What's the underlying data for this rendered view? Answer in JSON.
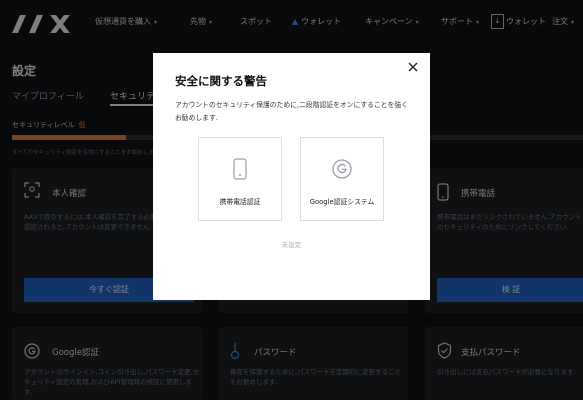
{
  "nav": {
    "logo": "AAX",
    "items": [
      "仮想通貨を購入",
      "先物",
      "スポット",
      "ウォレット",
      "キャンペーン",
      "サポート"
    ],
    "wallet_label": "ウォレット",
    "order_label": "注文"
  },
  "page": {
    "title": "設定",
    "tabs": [
      "マイプロフィール",
      "セキュリティ"
    ],
    "security_level_label": "セキュリティレベル",
    "security_level_value": "低",
    "security_level_fraction": 0.2,
    "hint": "すべてのセキュリティ設定を有効にすることをお勧めします"
  },
  "cards": {
    "identity": {
      "title": "本人確認",
      "desc": "AAXで取引するには,本人確認を完了する必要があります.認証されると,アカウントは変更できません.",
      "button": "今すぐ認証"
    },
    "phone": {
      "title": "携帯電話",
      "desc": "携帯電話はまだリンクされていません.アカウントのセキュリティのためにリンクしてください.",
      "button": "検 証"
    },
    "google": {
      "title": "Google認証",
      "desc": "アカウントのサインイン,コイン引き出し,パスワード変更,セキュリティ設定の管理,およびAPI管理時の検証に使用します."
    },
    "password": {
      "title": "パスワード",
      "desc": "資産を保護するために,パスワードを定期的に変更することをお勧めします."
    },
    "fund_password": {
      "title": "支払パスワード",
      "desc": "引き出しには支払パスワードが必要になります."
    }
  },
  "modal": {
    "title": "安全に関する警告",
    "desc": "アカウントのセキュリティ保護のために,二段階認証をオンにすることを強くお勧めします.",
    "options": [
      {
        "label": "携帯電話認証",
        "icon": "phone-icon"
      },
      {
        "label": "Google認証システム",
        "icon": "google-icon"
      }
    ],
    "unset_label": "未設定"
  },
  "colors": {
    "accent_blue": "#1f5fbf",
    "level_orange": "#e07a36",
    "background": "#0f1114"
  }
}
